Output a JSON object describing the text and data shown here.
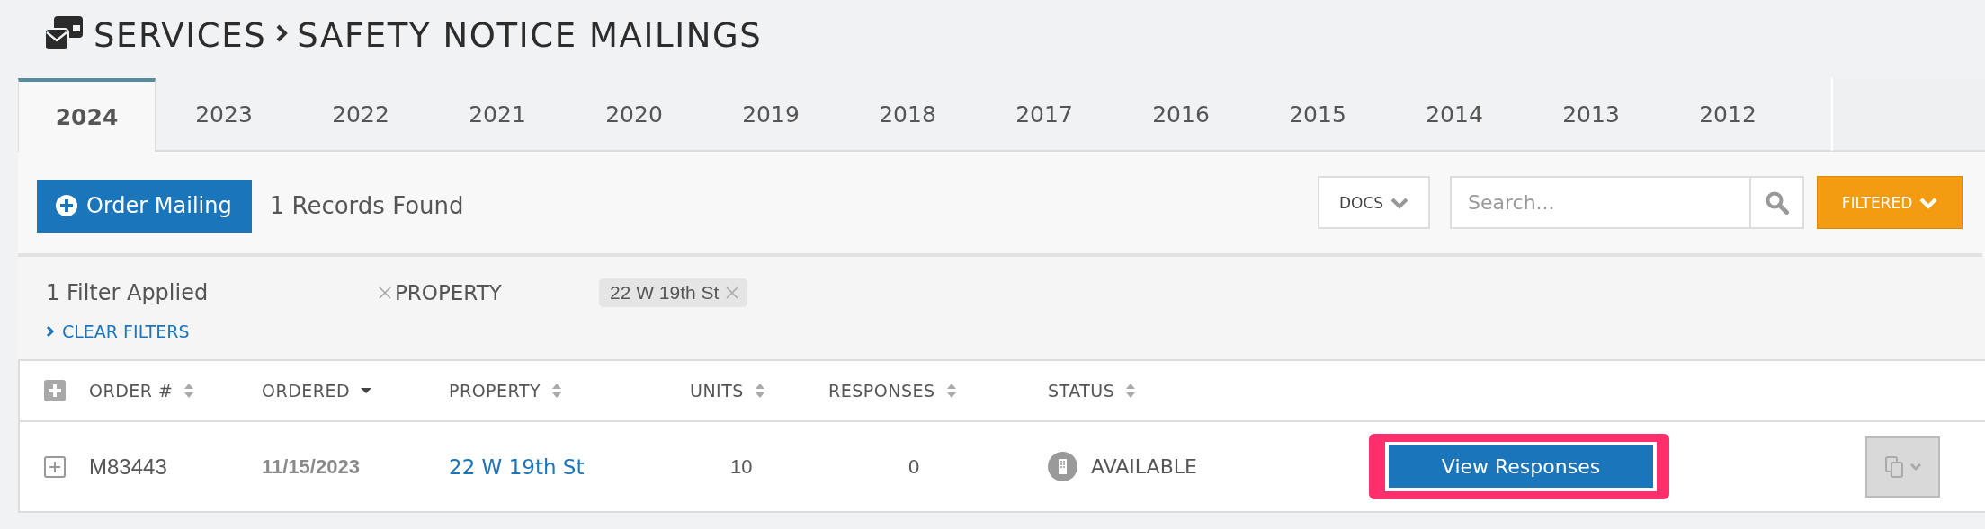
{
  "header": {
    "breadcrumb": [
      "SERVICES",
      "SAFETY NOTICE MAILINGS"
    ]
  },
  "tabs": [
    {
      "label": "2024",
      "selected": true
    },
    {
      "label": "2023",
      "selected": false
    },
    {
      "label": "2022",
      "selected": false
    },
    {
      "label": "2021",
      "selected": false
    },
    {
      "label": "2020",
      "selected": false
    },
    {
      "label": "2019",
      "selected": false
    },
    {
      "label": "2018",
      "selected": false
    },
    {
      "label": "2017",
      "selected": false
    },
    {
      "label": "2016",
      "selected": false
    },
    {
      "label": "2015",
      "selected": false
    },
    {
      "label": "2014",
      "selected": false
    },
    {
      "label": "2013",
      "selected": false
    },
    {
      "label": "2012",
      "selected": false
    }
  ],
  "toolbar": {
    "order_button": "Order Mailing",
    "records": "1 Records Found",
    "docs_button": "DOCS",
    "search": {
      "placeholder": "Search..."
    },
    "filter_button": "FILTERED"
  },
  "filters": {
    "summary": "1 Filter Applied",
    "field": "PROPERTY",
    "chips": [
      "22 W 19th St"
    ],
    "clear": "CLEAR FILTERS"
  },
  "table": {
    "columns": [
      {
        "label": "ORDER #",
        "sorted": false
      },
      {
        "label": "ORDERED",
        "sorted": true
      },
      {
        "label": "PROPERTY",
        "sorted": false
      },
      {
        "label": "UNITS",
        "sorted": false
      },
      {
        "label": "RESPONSES",
        "sorted": false
      },
      {
        "label": "STATUS",
        "sorted": false
      }
    ],
    "rows": [
      {
        "order": "M83443",
        "ordered": "11/15/2023",
        "property": "22 W 19th St",
        "units": "10",
        "responses": "0",
        "status": "AVAILABLE",
        "action": "View Responses",
        "highlighted": true
      }
    ]
  }
}
